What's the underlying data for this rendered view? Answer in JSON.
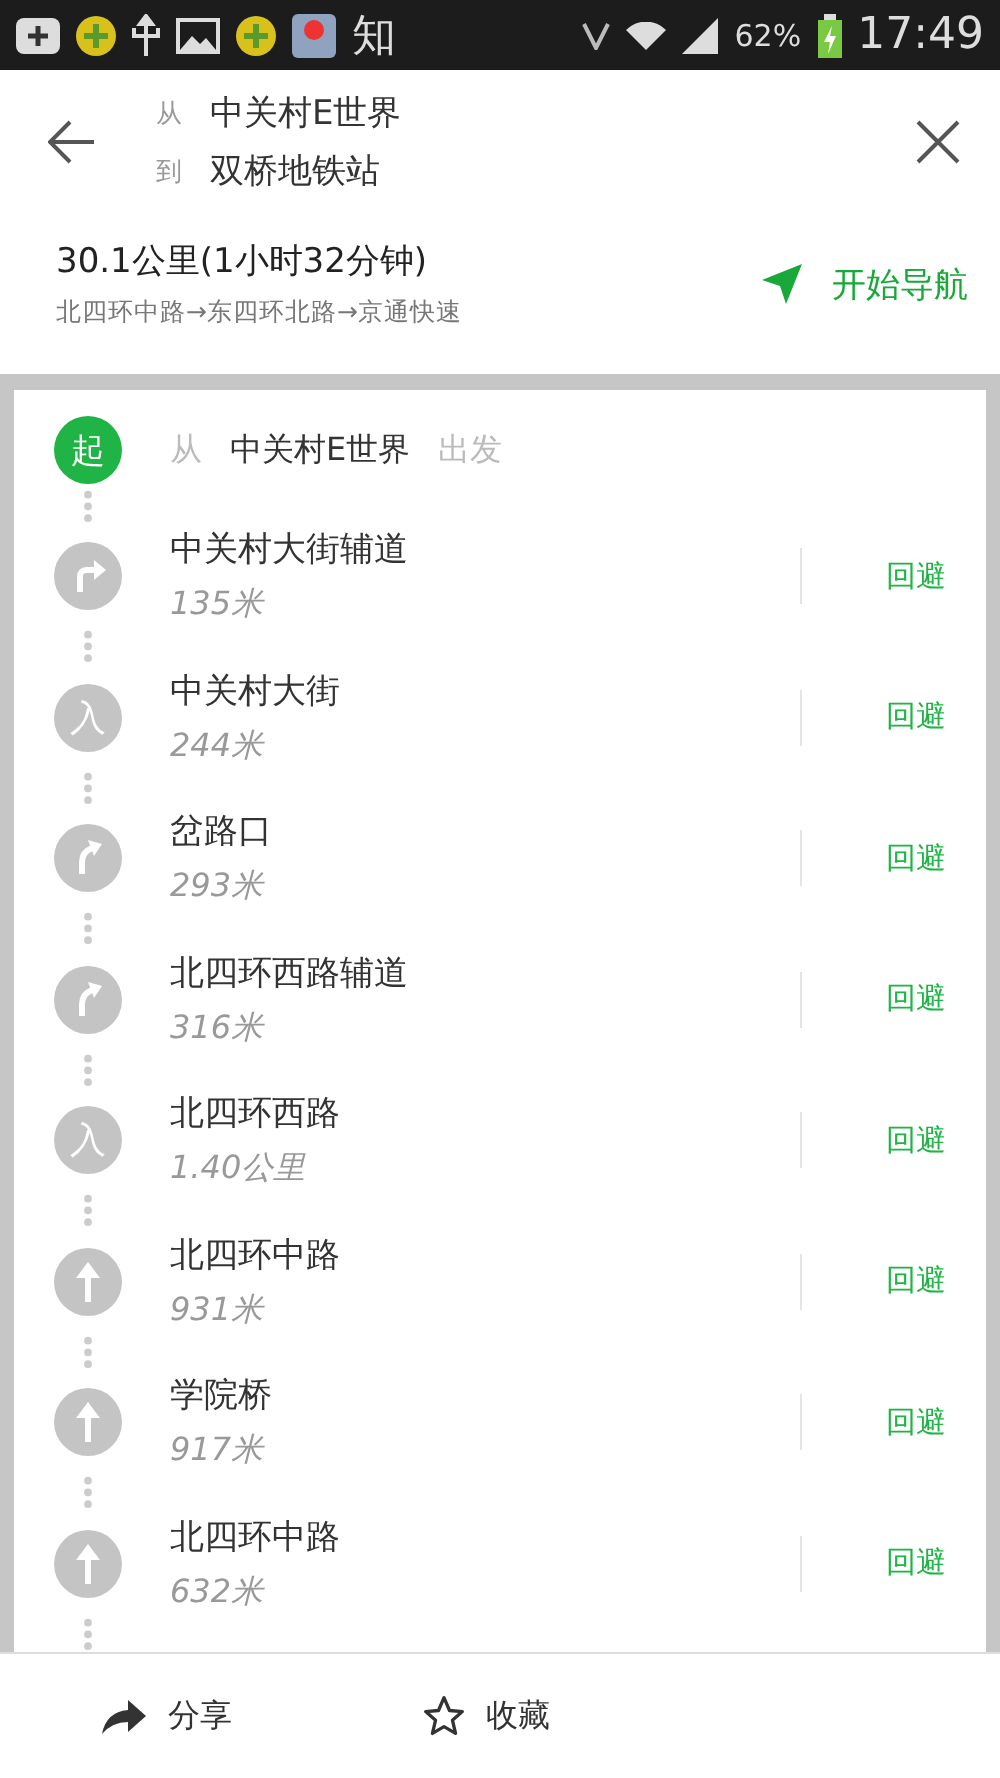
{
  "status_bar": {
    "app_label": "知",
    "battery": "62%",
    "time": "17:49"
  },
  "route": {
    "from_label": "从",
    "from": "中关村E世界",
    "to_label": "到",
    "to": "双桥地铁站"
  },
  "summary": {
    "distance": "30.1公里(1小时32分钟)",
    "roads": "北四环中路→东四环北路→京通快速",
    "navigate": "开始导航"
  },
  "start": {
    "badge": "起",
    "prefix": "从",
    "place": "中关村E世界",
    "suffix": "出发"
  },
  "steps": [
    {
      "kind": "turn-right",
      "road": "中关村大街辅道",
      "distance": "135米",
      "action": "回避"
    },
    {
      "kind": "glyph",
      "glyph": "入",
      "road": "中关村大街",
      "distance": "244米",
      "action": "回避"
    },
    {
      "kind": "bear-right",
      "road": "岔路口",
      "distance": "293米",
      "action": "回避"
    },
    {
      "kind": "bear-right",
      "road": "北四环西路辅道",
      "distance": "316米",
      "action": "回避"
    },
    {
      "kind": "glyph",
      "glyph": "入",
      "road": "北四环西路",
      "distance": "1.40公里",
      "action": "回避"
    },
    {
      "kind": "straight",
      "road": "北四环中路",
      "distance": "931米",
      "action": "回避"
    },
    {
      "kind": "straight",
      "road": "学院桥",
      "distance": "917米",
      "action": "回避"
    },
    {
      "kind": "straight",
      "road": "北四环中路",
      "distance": "632米",
      "action": "回避"
    }
  ],
  "bottom_bar": [
    {
      "kind": "share",
      "label": "分享"
    },
    {
      "kind": "favorite",
      "label": "收藏"
    }
  ]
}
